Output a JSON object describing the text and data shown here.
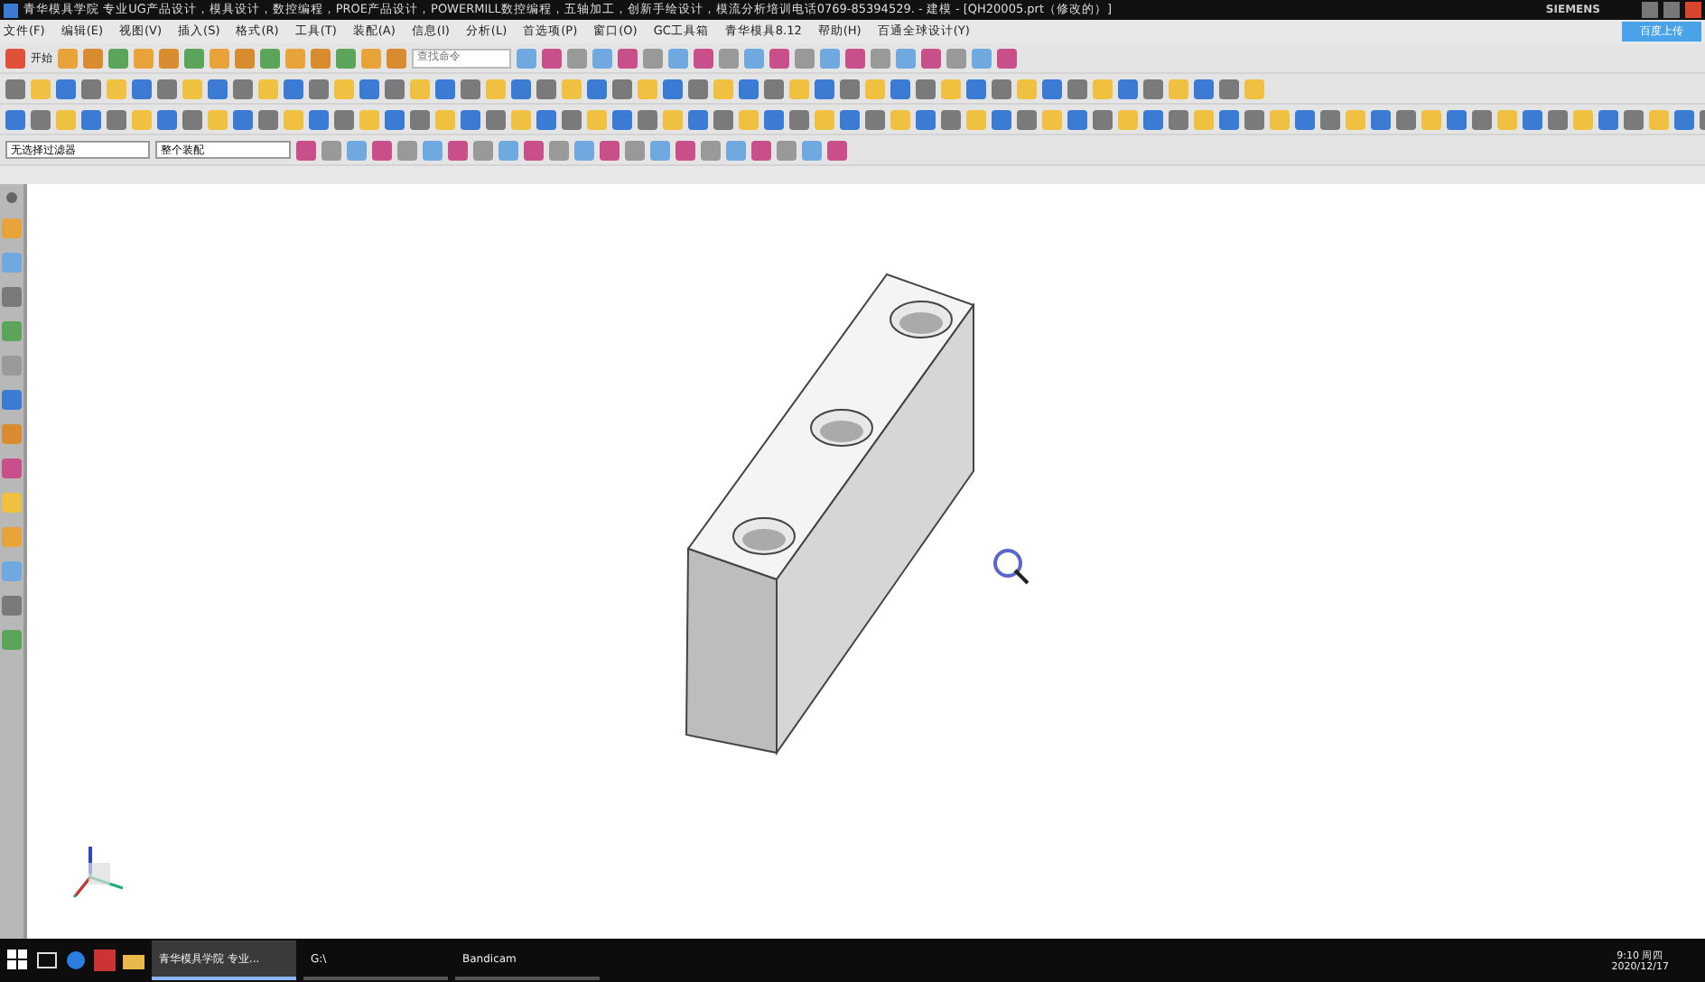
{
  "window": {
    "title": "青华模具学院 专业UG产品设计，模具设计，数控编程，PROE产品设计，POWERMILL数控编程，五轴加工，创新手绘设计，模流分析培训电话0769-85394529. - 建模 - [QH20005.prt（修改的）]",
    "brand": "SIEMENS"
  },
  "menu": [
    "文件(F)",
    "编辑(E)",
    "视图(V)",
    "插入(S)",
    "格式(R)",
    "工具(T)",
    "装配(A)",
    "信息(I)",
    "分析(L)",
    "首选项(P)",
    "窗口(O)",
    "GC工具箱",
    "青华模具8.12",
    "帮助(H)",
    "百通全球设计(Y)"
  ],
  "upload_button": "百度上传",
  "start_button": "开始",
  "command_search": {
    "placeholder": "查找命令"
  },
  "filters": [
    {
      "value": "无选择过滤器"
    },
    {
      "value": "整个装配"
    }
  ],
  "taskbar": {
    "apps": [
      {
        "label": "青华模具学院 专业...",
        "selected": true
      },
      {
        "label": "G:\\",
        "selected": false
      },
      {
        "label": "Bandicam",
        "selected": false
      }
    ],
    "time": "9:10 周四",
    "date": "2020/12/17"
  }
}
